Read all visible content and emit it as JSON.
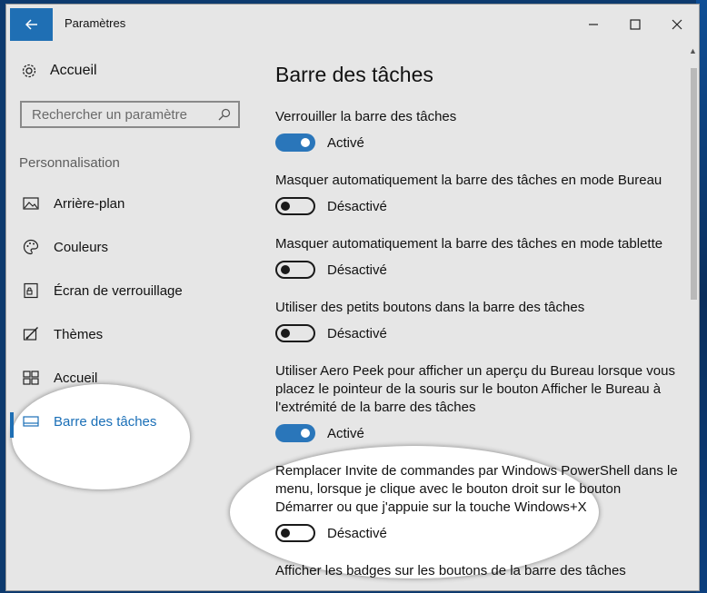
{
  "window": {
    "title": "Paramètres"
  },
  "controls": [
    "minimize-icon",
    "maximize-icon",
    "close-icon"
  ],
  "sidebar": {
    "home_label": "Accueil",
    "search": {
      "placeholder": "Rechercher un paramètre"
    },
    "section_label": "Personnalisation",
    "items": [
      {
        "label": "Arrière-plan",
        "icon": "image-icon"
      },
      {
        "label": "Couleurs",
        "icon": "palette-icon"
      },
      {
        "label": "Écran de verrouillage",
        "icon": "lock-screen-icon"
      },
      {
        "label": "Thèmes",
        "icon": "themes-icon"
      },
      {
        "label": "Accueil",
        "icon": "start-icon"
      },
      {
        "label": "Barre des tâches",
        "icon": "taskbar-icon",
        "selected": true
      }
    ]
  },
  "main": {
    "title": "Barre des tâches",
    "settings": [
      {
        "label": "Verrouiller la barre des tâches",
        "on": true,
        "state": "Activé"
      },
      {
        "label": "Masquer automatiquement la barre des tâches en mode Bureau",
        "on": false,
        "state": "Désactivé"
      },
      {
        "label": "Masquer automatiquement la barre des tâches en mode tablette",
        "on": false,
        "state": "Désactivé"
      },
      {
        "label": "Utiliser des petits boutons dans la barre des tâches",
        "on": false,
        "state": "Désactivé"
      },
      {
        "label": "Utiliser Aero Peek pour afficher un aperçu du Bureau lorsque vous placez le pointeur de la souris sur le bouton Afficher le Bureau à l'extrémité de la barre des tâches",
        "on": true,
        "state": "Activé"
      },
      {
        "label": "Remplacer Invite de commandes par Windows PowerShell dans le menu, lorsque je clique avec le bouton droit sur le bouton Démarrer ou que j'appuie sur la touche Windows+X",
        "on": false,
        "state": "Désactivé"
      },
      {
        "label": "Afficher les badges sur les boutons de la barre des tâches"
      }
    ]
  },
  "colors": {
    "accent": "#1f6fb4",
    "toggle_on": "#2a76ba",
    "background": "#e6e6e6"
  }
}
